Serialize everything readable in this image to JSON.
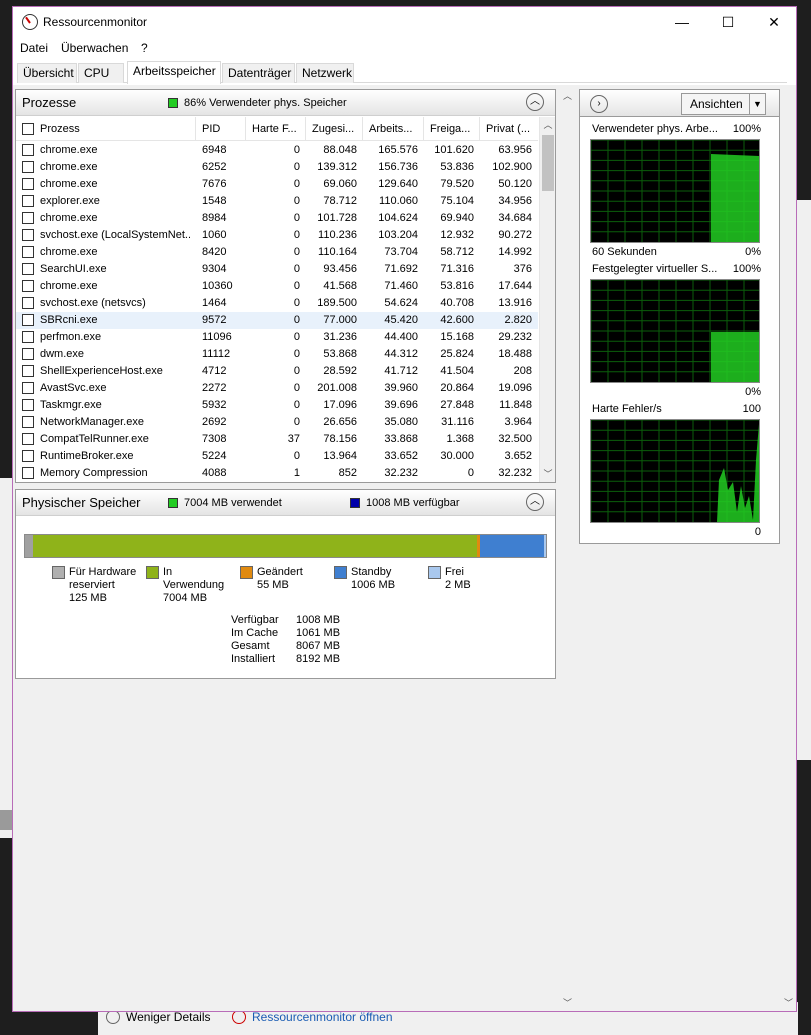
{
  "window": {
    "title": "Ressourcenmonitor",
    "minimize": "—",
    "maximize": "☐",
    "close": "✕"
  },
  "menu": [
    "Datei",
    "Überwachen",
    "?"
  ],
  "tabs": [
    "Übersicht",
    "CPU",
    "Arbeitsspeicher",
    "Datenträger",
    "Netzwerk"
  ],
  "active_tab": "Arbeitsspeicher",
  "processes": {
    "title": "Prozesse",
    "status": "86% Verwendeter phys. Speicher",
    "status_color": "#22cc22",
    "columns": [
      "Prozess",
      "PID",
      "Harte F...",
      "Zugesi...",
      "Arbeits...",
      "Freiga...",
      "Privat (..."
    ],
    "rows": [
      [
        "chrome.exe",
        "6948",
        "0",
        "88.048",
        "165.576",
        "101.620",
        "63.956"
      ],
      [
        "chrome.exe",
        "6252",
        "0",
        "139.312",
        "156.736",
        "53.836",
        "102.900"
      ],
      [
        "chrome.exe",
        "7676",
        "0",
        "69.060",
        "129.640",
        "79.520",
        "50.120"
      ],
      [
        "explorer.exe",
        "1548",
        "0",
        "78.712",
        "110.060",
        "75.104",
        "34.956"
      ],
      [
        "chrome.exe",
        "8984",
        "0",
        "101.728",
        "104.624",
        "69.940",
        "34.684"
      ],
      [
        "svchost.exe (LocalSystemNet...",
        "1060",
        "0",
        "110.236",
        "103.204",
        "12.932",
        "90.272"
      ],
      [
        "chrome.exe",
        "8420",
        "0",
        "110.164",
        "73.704",
        "58.712",
        "14.992"
      ],
      [
        "SearchUI.exe",
        "9304",
        "0",
        "93.456",
        "71.692",
        "71.316",
        "376"
      ],
      [
        "chrome.exe",
        "10360",
        "0",
        "41.568",
        "71.460",
        "53.816",
        "17.644"
      ],
      [
        "svchost.exe (netsvcs)",
        "1464",
        "0",
        "189.500",
        "54.624",
        "40.708",
        "13.916"
      ],
      [
        "SBRcni.exe",
        "9572",
        "0",
        "77.000",
        "45.420",
        "42.600",
        "2.820"
      ],
      [
        "perfmon.exe",
        "11096",
        "0",
        "31.236",
        "44.400",
        "15.168",
        "29.232"
      ],
      [
        "dwm.exe",
        "11112",
        "0",
        "53.868",
        "44.312",
        "25.824",
        "18.488"
      ],
      [
        "ShellExperienceHost.exe",
        "4712",
        "0",
        "28.592",
        "41.712",
        "41.504",
        "208"
      ],
      [
        "AvastSvc.exe",
        "2272",
        "0",
        "201.008",
        "39.960",
        "20.864",
        "19.096"
      ],
      [
        "Taskmgr.exe",
        "5932",
        "0",
        "17.096",
        "39.696",
        "27.848",
        "11.848"
      ],
      [
        "NetworkManager.exe",
        "2692",
        "0",
        "26.656",
        "35.080",
        "31.116",
        "3.964"
      ],
      [
        "CompatTelRunner.exe",
        "7308",
        "37",
        "78.156",
        "33.868",
        "1.368",
        "32.500"
      ],
      [
        "RuntimeBroker.exe",
        "5224",
        "0",
        "13.964",
        "33.652",
        "30.000",
        "3.652"
      ],
      [
        "Memory Compression",
        "4088",
        "1",
        "852",
        "32.232",
        "0",
        "32.232"
      ]
    ],
    "selected_row": 10
  },
  "physical": {
    "title": "Physischer Speicher",
    "used_text": "7004 MB verwendet",
    "used_color": "#22cc22",
    "available_text": "1008 MB verfügbar",
    "available_color": "#0000aa",
    "bar": [
      {
        "name": "hardware",
        "mb": 125,
        "color": "#a0a0a0"
      },
      {
        "name": "in_use",
        "mb": 7004,
        "color": "#8fb31a"
      },
      {
        "name": "modified",
        "mb": 55,
        "color": "#e08a10"
      },
      {
        "name": "standby",
        "mb": 1006,
        "color": "#3f7fd0"
      },
      {
        "name": "free",
        "mb": 2,
        "color": "#a9c8ee"
      }
    ],
    "legend": [
      {
        "l1": "Für Hardware",
        "l2": "reserviert",
        "l3": "125 MB",
        "color": "#b0b0b0"
      },
      {
        "l1": "In",
        "l2": "Verwendung",
        "l3": "7004 MB",
        "color": "#8fb31a"
      },
      {
        "l1": "Geändert",
        "l2": "55 MB",
        "l3": "",
        "color": "#e08a10"
      },
      {
        "l1": "Standby",
        "l2": "1006 MB",
        "l3": "",
        "color": "#3f7fd0"
      },
      {
        "l1": "Frei",
        "l2": "2 MB",
        "l3": "",
        "color": "#a9c8ee"
      }
    ],
    "totals": [
      {
        "k": "Verfügbar",
        "v": "1008 MB"
      },
      {
        "k": "Im Cache",
        "v": "1061 MB"
      },
      {
        "k": "Gesamt",
        "v": "8067 MB"
      },
      {
        "k": "Installiert",
        "v": "8192 MB"
      }
    ]
  },
  "right_pane": {
    "views_label": "Ansichten",
    "graphs": [
      {
        "label": "Verwendeter phys. Arbe...",
        "max": "100%",
        "min": "0%",
        "footer": "60 Sekunden"
      },
      {
        "label": "Festgelegter virtueller S...",
        "max": "100%",
        "min": "0%",
        "footer": ""
      },
      {
        "label": "Harte Fehler/s",
        "max": "100",
        "min": "0",
        "footer": ""
      }
    ],
    "graph_color": "#22cc22"
  },
  "background": {
    "less_details": "Weniger Details",
    "open_monitor": "Ressourcenmonitor öffnen"
  }
}
